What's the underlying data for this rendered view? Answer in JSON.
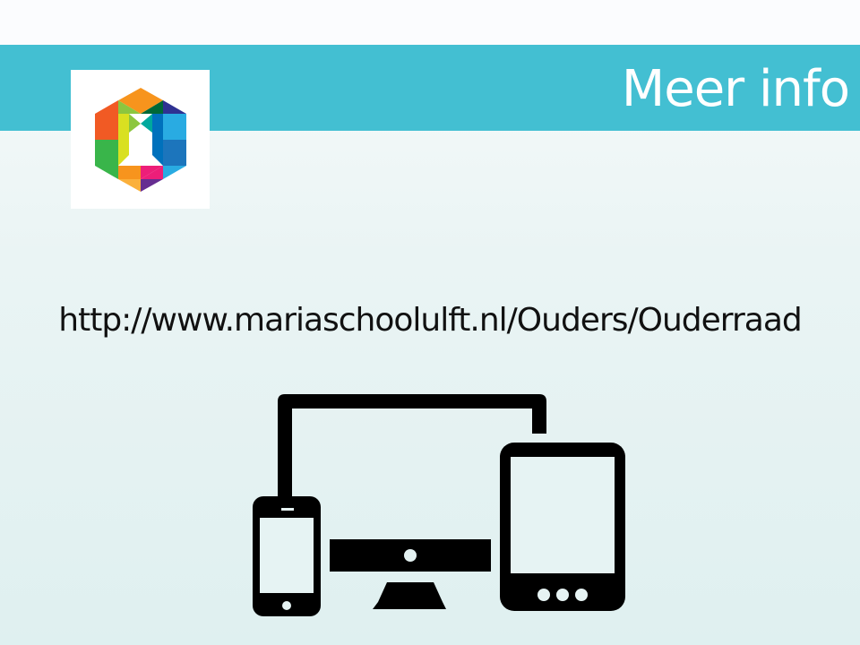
{
  "slide": {
    "title": "Meer info",
    "url": "http://www.mariaschoolulft.nl/Ouders/Ouderraad"
  },
  "colors": {
    "title_bar": "#43bfd2",
    "title_text": "#ffffff",
    "body_text": "#111111",
    "icon": "#000000"
  },
  "icons": {
    "logo": "school-logo-hexagon",
    "devices": "responsive-devices-icon"
  }
}
